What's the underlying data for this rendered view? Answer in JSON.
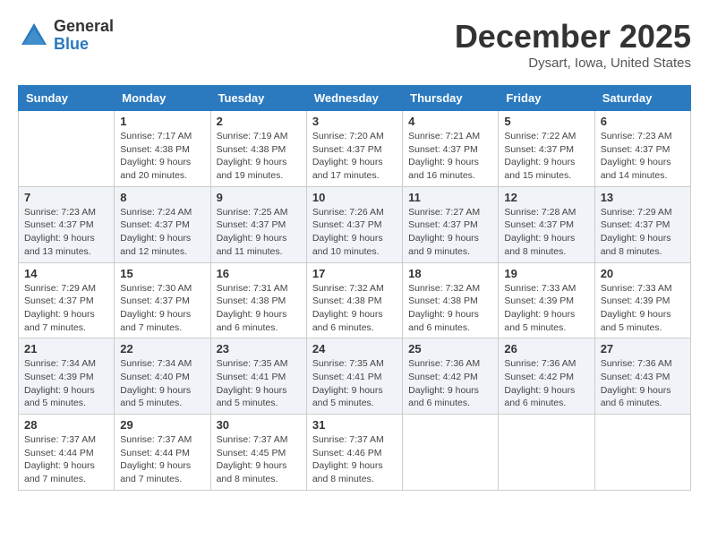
{
  "logo": {
    "general": "General",
    "blue": "Blue"
  },
  "header": {
    "month": "December 2025",
    "location": "Dysart, Iowa, United States"
  },
  "days_of_week": [
    "Sunday",
    "Monday",
    "Tuesday",
    "Wednesday",
    "Thursday",
    "Friday",
    "Saturday"
  ],
  "weeks": [
    [
      {
        "day": "",
        "info": ""
      },
      {
        "day": "1",
        "info": "Sunrise: 7:17 AM\nSunset: 4:38 PM\nDaylight: 9 hours\nand 20 minutes."
      },
      {
        "day": "2",
        "info": "Sunrise: 7:19 AM\nSunset: 4:38 PM\nDaylight: 9 hours\nand 19 minutes."
      },
      {
        "day": "3",
        "info": "Sunrise: 7:20 AM\nSunset: 4:37 PM\nDaylight: 9 hours\nand 17 minutes."
      },
      {
        "day": "4",
        "info": "Sunrise: 7:21 AM\nSunset: 4:37 PM\nDaylight: 9 hours\nand 16 minutes."
      },
      {
        "day": "5",
        "info": "Sunrise: 7:22 AM\nSunset: 4:37 PM\nDaylight: 9 hours\nand 15 minutes."
      },
      {
        "day": "6",
        "info": "Sunrise: 7:23 AM\nSunset: 4:37 PM\nDaylight: 9 hours\nand 14 minutes."
      }
    ],
    [
      {
        "day": "7",
        "info": "Sunrise: 7:23 AM\nSunset: 4:37 PM\nDaylight: 9 hours\nand 13 minutes."
      },
      {
        "day": "8",
        "info": "Sunrise: 7:24 AM\nSunset: 4:37 PM\nDaylight: 9 hours\nand 12 minutes."
      },
      {
        "day": "9",
        "info": "Sunrise: 7:25 AM\nSunset: 4:37 PM\nDaylight: 9 hours\nand 11 minutes."
      },
      {
        "day": "10",
        "info": "Sunrise: 7:26 AM\nSunset: 4:37 PM\nDaylight: 9 hours\nand 10 minutes."
      },
      {
        "day": "11",
        "info": "Sunrise: 7:27 AM\nSunset: 4:37 PM\nDaylight: 9 hours\nand 9 minutes."
      },
      {
        "day": "12",
        "info": "Sunrise: 7:28 AM\nSunset: 4:37 PM\nDaylight: 9 hours\nand 8 minutes."
      },
      {
        "day": "13",
        "info": "Sunrise: 7:29 AM\nSunset: 4:37 PM\nDaylight: 9 hours\nand 8 minutes."
      }
    ],
    [
      {
        "day": "14",
        "info": "Sunrise: 7:29 AM\nSunset: 4:37 PM\nDaylight: 9 hours\nand 7 minutes."
      },
      {
        "day": "15",
        "info": "Sunrise: 7:30 AM\nSunset: 4:37 PM\nDaylight: 9 hours\nand 7 minutes."
      },
      {
        "day": "16",
        "info": "Sunrise: 7:31 AM\nSunset: 4:38 PM\nDaylight: 9 hours\nand 6 minutes."
      },
      {
        "day": "17",
        "info": "Sunrise: 7:32 AM\nSunset: 4:38 PM\nDaylight: 9 hours\nand 6 minutes."
      },
      {
        "day": "18",
        "info": "Sunrise: 7:32 AM\nSunset: 4:38 PM\nDaylight: 9 hours\nand 6 minutes."
      },
      {
        "day": "19",
        "info": "Sunrise: 7:33 AM\nSunset: 4:39 PM\nDaylight: 9 hours\nand 5 minutes."
      },
      {
        "day": "20",
        "info": "Sunrise: 7:33 AM\nSunset: 4:39 PM\nDaylight: 9 hours\nand 5 minutes."
      }
    ],
    [
      {
        "day": "21",
        "info": "Sunrise: 7:34 AM\nSunset: 4:39 PM\nDaylight: 9 hours\nand 5 minutes."
      },
      {
        "day": "22",
        "info": "Sunrise: 7:34 AM\nSunset: 4:40 PM\nDaylight: 9 hours\nand 5 minutes."
      },
      {
        "day": "23",
        "info": "Sunrise: 7:35 AM\nSunset: 4:41 PM\nDaylight: 9 hours\nand 5 minutes."
      },
      {
        "day": "24",
        "info": "Sunrise: 7:35 AM\nSunset: 4:41 PM\nDaylight: 9 hours\nand 5 minutes."
      },
      {
        "day": "25",
        "info": "Sunrise: 7:36 AM\nSunset: 4:42 PM\nDaylight: 9 hours\nand 6 minutes."
      },
      {
        "day": "26",
        "info": "Sunrise: 7:36 AM\nSunset: 4:42 PM\nDaylight: 9 hours\nand 6 minutes."
      },
      {
        "day": "27",
        "info": "Sunrise: 7:36 AM\nSunset: 4:43 PM\nDaylight: 9 hours\nand 6 minutes."
      }
    ],
    [
      {
        "day": "28",
        "info": "Sunrise: 7:37 AM\nSunset: 4:44 PM\nDaylight: 9 hours\nand 7 minutes."
      },
      {
        "day": "29",
        "info": "Sunrise: 7:37 AM\nSunset: 4:44 PM\nDaylight: 9 hours\nand 7 minutes."
      },
      {
        "day": "30",
        "info": "Sunrise: 7:37 AM\nSunset: 4:45 PM\nDaylight: 9 hours\nand 8 minutes."
      },
      {
        "day": "31",
        "info": "Sunrise: 7:37 AM\nSunset: 4:46 PM\nDaylight: 9 hours\nand 8 minutes."
      },
      {
        "day": "",
        "info": ""
      },
      {
        "day": "",
        "info": ""
      },
      {
        "day": "",
        "info": ""
      }
    ]
  ]
}
